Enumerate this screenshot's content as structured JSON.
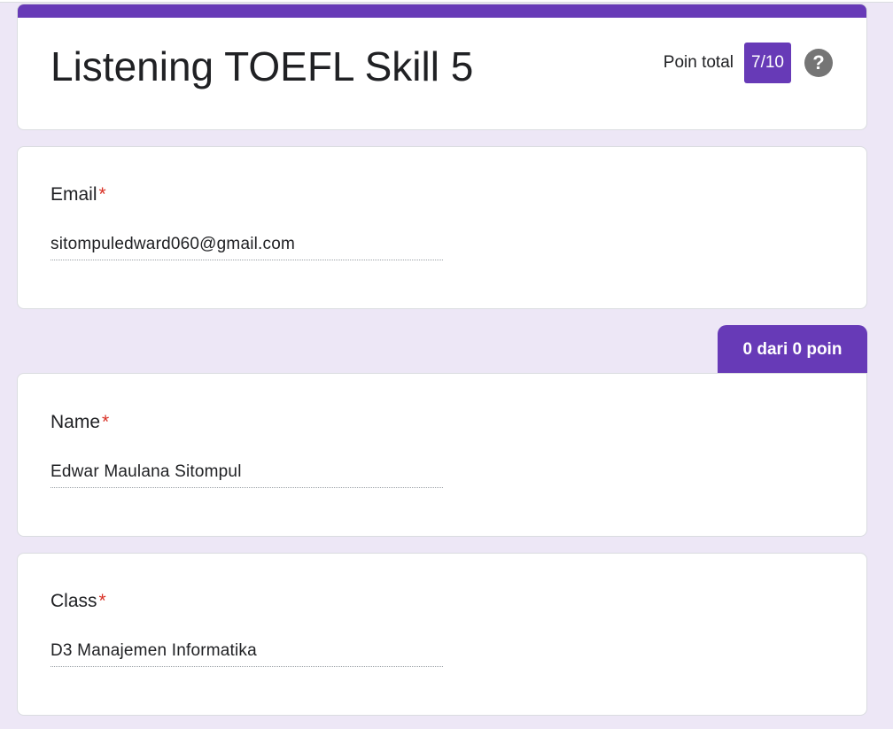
{
  "header": {
    "title": "Listening TOEFL Skill 5",
    "score_label": "Poin total",
    "score_value": "7/10",
    "help_glyph": "?"
  },
  "email": {
    "label": "Email",
    "required": "*",
    "value": "sitompuledward060@gmail.com"
  },
  "section": {
    "points": "0 dari 0 poin"
  },
  "name": {
    "label": "Name",
    "required": "*",
    "value": "Edwar Maulana Sitompul"
  },
  "class_field": {
    "label": "Class",
    "required": "*",
    "value": "D3 Manajemen Informatika"
  },
  "colors": {
    "accent": "#673ab7",
    "background": "#ede7f6",
    "required": "#d93025"
  }
}
